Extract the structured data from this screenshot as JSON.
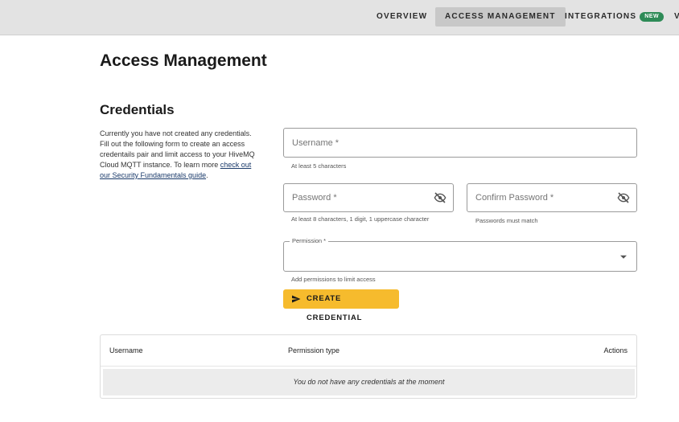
{
  "nav": {
    "items": [
      {
        "label": "OVERVIEW"
      },
      {
        "label": "ACCESS MANAGEMENT"
      },
      {
        "label": "INTEGRATIONS"
      }
    ],
    "new_badge": "NEW",
    "overflow": "V"
  },
  "page": {
    "title": "Access Management",
    "section_title": "Credentials",
    "description": "Currently you have not created any credentials. Fill out the following form to create an access credentails pair and limit access to your HiveMQ Cloud MQTT instance. To learn more ",
    "description_link": "check out our Security Fundamentals guide",
    "description_end": "."
  },
  "form": {
    "username": {
      "placeholder": "Username *",
      "helper": "At least 5 characters"
    },
    "password": {
      "placeholder": "Password *",
      "helper": "At least 8 characters, 1 digit, 1 uppercase character"
    },
    "confirm_password": {
      "placeholder": "Confirm Password *",
      "helper": "Passwords must match"
    },
    "permission": {
      "label": "Permission *",
      "helper": "Add permissions to limit access"
    },
    "submit_label": "CREATE CREDENTIAL"
  },
  "table": {
    "columns": [
      "Username",
      "Permission type",
      "Actions"
    ],
    "empty_message": "You do not have any credentials at the moment"
  },
  "colors": {
    "accent": "#f6bb2d",
    "badge": "#2e8b57",
    "topbar": "#e3e3e3"
  }
}
